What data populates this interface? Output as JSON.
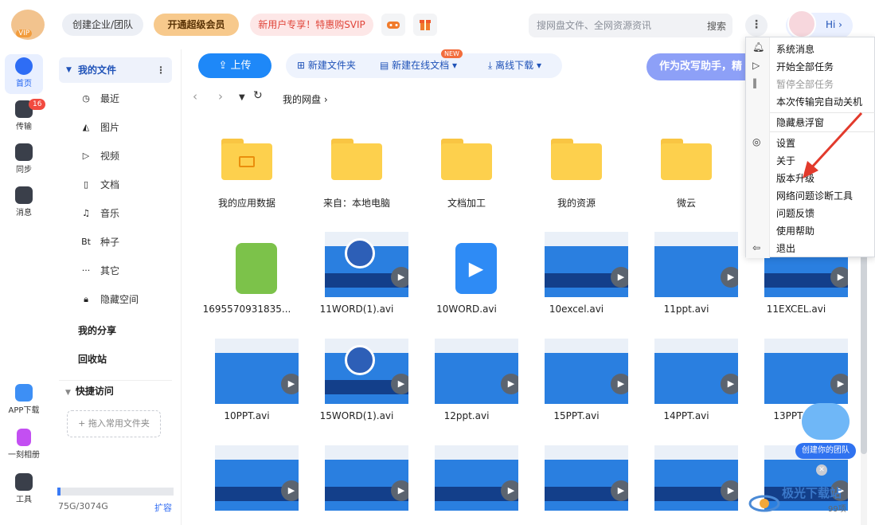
{
  "topbar": {
    "logo_vip": "VIP",
    "team_btn": "创建企业/团队",
    "vip_btn": "开通超级会员",
    "svip_btn": "新用户专享！特惠购SVIP",
    "search_placeholder": "搜网盘文件、全网资源资讯",
    "search_btn": "搜索",
    "more": "⋮",
    "user_hi": "Hi ›"
  },
  "rail": {
    "home": "首页",
    "transfer": "传输",
    "transfer_badge": "16",
    "sync": "同步",
    "messages": "消息",
    "app_download": "APP下载",
    "album": "一刻相册",
    "tools": "工具"
  },
  "nav": {
    "my_files": "我的文件",
    "items": [
      {
        "icon": "clock-icon",
        "glyph": "◷",
        "label": "最近"
      },
      {
        "icon": "image-icon",
        "glyph": "◭",
        "label": "图片"
      },
      {
        "icon": "video-icon",
        "glyph": "▷",
        "label": "视频"
      },
      {
        "icon": "doc-icon",
        "glyph": "▯",
        "label": "文档"
      },
      {
        "icon": "music-icon",
        "glyph": "♫",
        "label": "音乐"
      },
      {
        "icon": "bt-icon",
        "glyph": "Bt",
        "label": "种子"
      },
      {
        "icon": "more-icon",
        "glyph": "···",
        "label": "其它"
      },
      {
        "icon": "lock-icon",
        "glyph": "🔒︎",
        "label": "隐藏空间"
      }
    ],
    "my_share": "我的分享",
    "recycle": "回收站",
    "quick_access": "快捷访问",
    "add_common": "+ 拖入常用文件夹",
    "storage": "75G/3074G",
    "storage_fraction": 0.024,
    "expand": "扩容"
  },
  "toolbar": {
    "upload": "上传",
    "new_folder": "新建文件夹",
    "new_doc": "新建在线文档 ▾",
    "new_badge": "NEW",
    "offline_dl": "离线下载 ▾",
    "assistant": "作为改写助手，精"
  },
  "breadcrumb": {
    "path": "我的网盘  ›"
  },
  "files": {
    "row1": [
      "我的应用数据",
      "来自：本地电脑",
      "文档加工",
      "我的资源",
      "微云"
    ],
    "row2": [
      "1695570931835...",
      "11WORD(1).avi",
      "10WORD.avi",
      "10excel.avi",
      "11ppt.avi",
      "11EXCEL.avi"
    ],
    "row3": [
      "10PPT.avi",
      "15WORD(1).avi",
      "12ppt.avi",
      "15PPT.avi",
      "14PPT.avi",
      "13PPT.avi"
    ]
  },
  "menu": {
    "items": [
      "系统消息",
      "开始全部任务",
      "暂停全部任务",
      "本次传输完自动关机",
      "隐藏悬浮窗",
      "设置",
      "关于",
      "版本升级",
      "网络问题诊断工具",
      "问题反馈",
      "使用帮助",
      "退出"
    ]
  },
  "team_widget": {
    "label": "创建你的团队"
  },
  "watermark": {
    "text": "极光下载站",
    "sub": "99项"
  }
}
